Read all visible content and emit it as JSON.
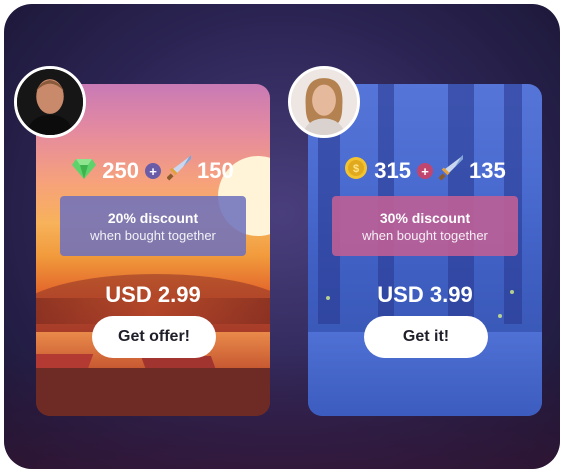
{
  "offers": [
    {
      "id": "left",
      "reward_a": {
        "icon": "gem-icon",
        "amount": "250"
      },
      "reward_b": {
        "icon": "sword-icon",
        "amount": "150"
      },
      "discount_title": "20% discount",
      "discount_sub": "when bought together",
      "price": "USD 2.99",
      "button_label": "Get offer!"
    },
    {
      "id": "right",
      "reward_a": {
        "icon": "coin-icon",
        "amount": "315"
      },
      "reward_b": {
        "icon": "sword-icon",
        "amount": "135"
      },
      "discount_title": "30% discount",
      "discount_sub": "when bought together",
      "price": "USD 3.99",
      "button_label": "Get it!"
    }
  ],
  "colors": {
    "panel": "#2b2453",
    "accent_purple": "#6b5ca8",
    "accent_pink": "#c1466f",
    "gem": "#5fd36b",
    "coin": "#f4c430"
  }
}
